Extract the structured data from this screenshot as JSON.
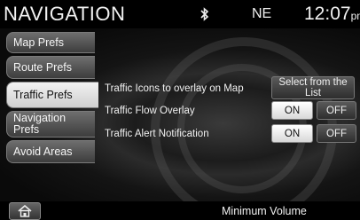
{
  "header": {
    "title": "NAVIGATION",
    "compass": "NE",
    "time": "12:07",
    "ampm": "pm"
  },
  "sidebar": {
    "items": [
      {
        "label": "Map Prefs",
        "active": false
      },
      {
        "label": "Route Prefs",
        "active": false
      },
      {
        "label": "Traffic Prefs",
        "active": true
      },
      {
        "label": "Navigation Prefs",
        "active": false
      },
      {
        "label": "Avoid Areas",
        "active": false
      }
    ]
  },
  "settings": {
    "traffic_icons": {
      "label": "Traffic Icons to overlay on Map",
      "button": "Select from the List"
    },
    "traffic_flow": {
      "label": "Traffic Flow Overlay",
      "on": "ON",
      "off": "OFF",
      "selected": "ON"
    },
    "traffic_alert": {
      "label": "Traffic Alert Notification",
      "on": "ON",
      "off": "OFF",
      "selected": "ON"
    }
  },
  "footer": {
    "status": "Minimum Volume",
    "home_icon": "home-icon"
  },
  "colors": {
    "active_tab": "#e8e8e8",
    "inactive_tab": "#555555",
    "background": "#000000"
  }
}
